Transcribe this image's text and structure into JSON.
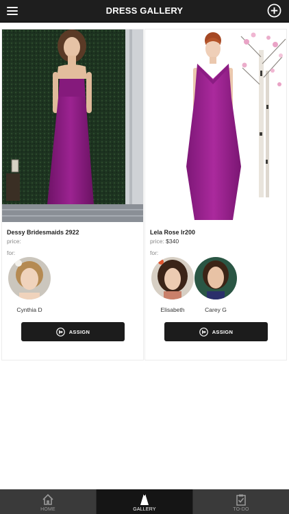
{
  "header": {
    "title": "DRESS GALLERY",
    "menu_icon": "hamburger-menu-icon",
    "add_icon": "plus-circle-icon"
  },
  "dresses": [
    {
      "name": "Dessy Bridesmaids 2922",
      "price_label": "price:",
      "price_value": "",
      "for_label": "for:",
      "people": [
        "Cynthia D"
      ],
      "assign_label": "ASSIGN",
      "dress_color": "#8e1d86"
    },
    {
      "name": "Lela Rose lr200",
      "price_label": "price:",
      "price_value": "$340",
      "for_label": "for:",
      "people": [
        "Elisabeth",
        "Carey G"
      ],
      "assign_label": "ASSIGN",
      "dress_color": "#a0208f"
    }
  ],
  "tabs": [
    {
      "label": "HOME",
      "icon": "home-icon",
      "active": false
    },
    {
      "label": "GALLERY",
      "icon": "dress-icon",
      "active": true
    },
    {
      "label": "TO-DO",
      "icon": "clipboard-check-icon",
      "active": false
    }
  ],
  "colors": {
    "header_bg": "#1e1e1e",
    "tabbar_bg": "#3a3a3a",
    "tab_active_bg": "#151515",
    "button_bg": "#1c1c1c"
  }
}
